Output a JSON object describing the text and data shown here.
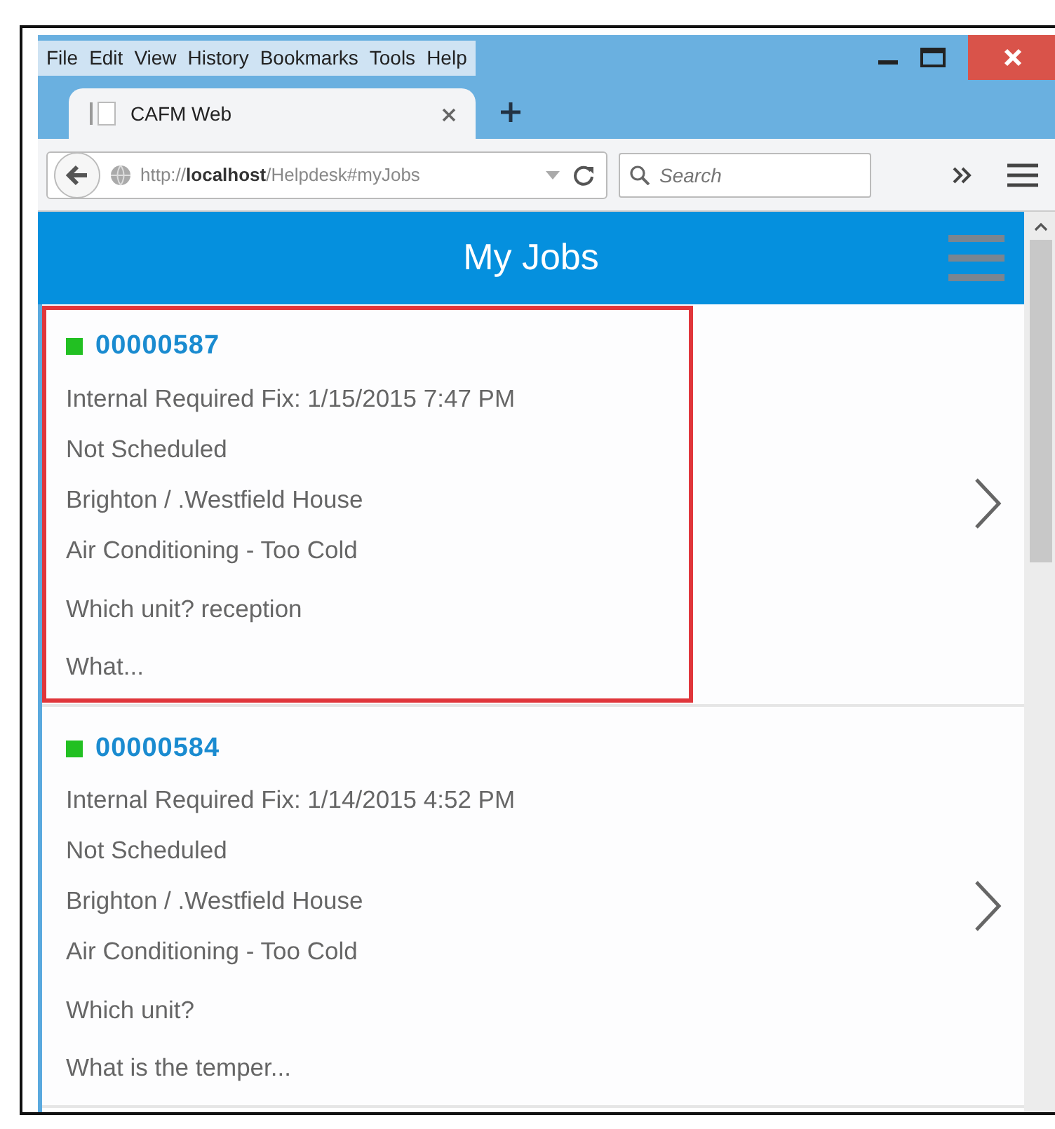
{
  "menu_bar": [
    {
      "label": "File"
    },
    {
      "label": "Edit"
    },
    {
      "label": "View"
    },
    {
      "label": "History"
    },
    {
      "label": "Bookmarks"
    },
    {
      "label": "Tools"
    },
    {
      "label": "Help"
    }
  ],
  "tabs": [
    {
      "label": "CAFM Web",
      "selected": true
    }
  ],
  "address_bar": {
    "url": "http://**localhost**/Helpdesk#myJobs"
  },
  "search": {
    "placeholder": "Search"
  },
  "page": {
    "title": "My Jobs"
  },
  "jobs": [
    {
      "number": "00000587",
      "color": "#22c022",
      "highlighted": true,
      "lines": [
        "Internal Required Fix: 1/15/2015 7:47 PM",
        "Not Scheduled",
        "Brighton / .Westfield House",
        "Air Conditioning - Too Cold"
      ],
      "notes": [
        "Which unit? reception",
        "What..."
      ]
    },
    {
      "number": "00000584",
      "color": "#22c022",
      "highlighted": false,
      "lines": [
        "Internal Required Fix: 1/14/2015 4:52 PM",
        "Not Scheduled",
        "Brighton / .Westfield House",
        "Air Conditioning - Too Cold"
      ],
      "notes": [
        "Which unit?",
        "What is the temper..."
      ]
    }
  ]
}
